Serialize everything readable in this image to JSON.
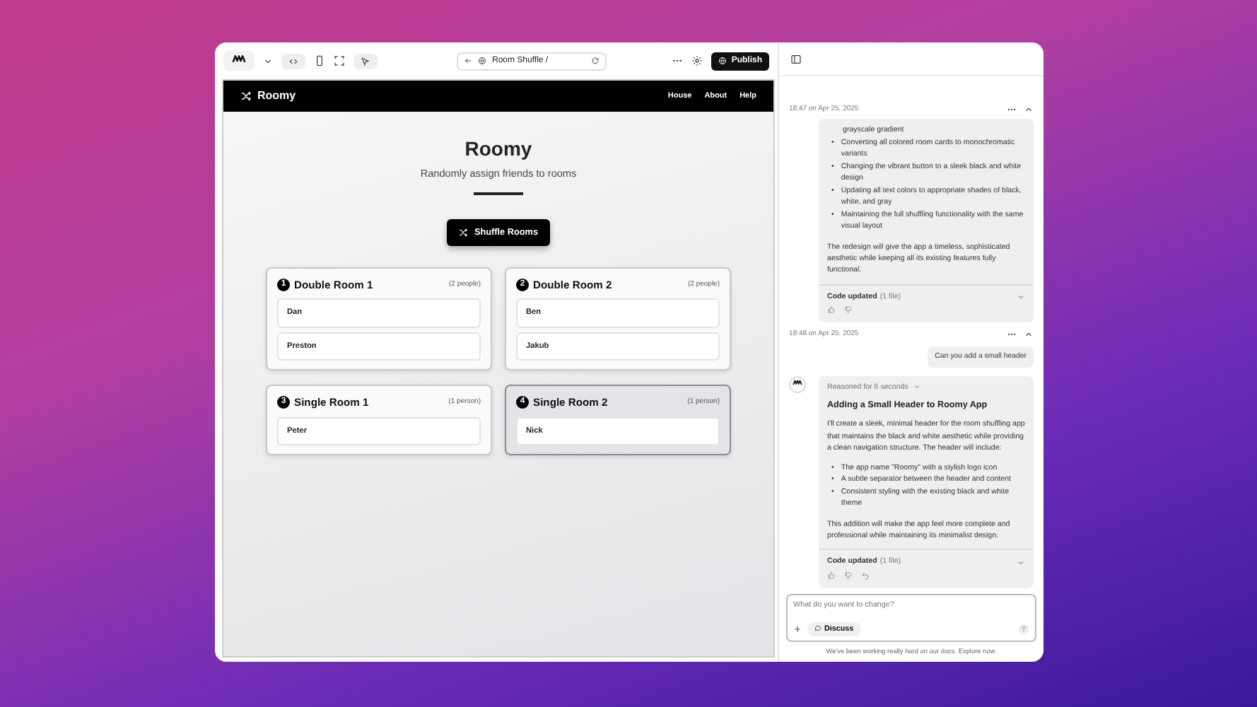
{
  "toolbar": {
    "url": "Room Shuffle /",
    "publish_label": "Publish"
  },
  "app": {
    "brand": "Roomy",
    "nav_links": [
      "House",
      "About",
      "Help"
    ],
    "title": "Roomy",
    "subtitle": "Randomly assign friends to rooms",
    "shuffle_label": "Shuffle Rooms",
    "rooms": [
      {
        "number": "1",
        "name": "Double Room 1",
        "capacity": "(2 people)",
        "highlighted": false,
        "people": [
          "Dan",
          "Preston"
        ]
      },
      {
        "number": "2",
        "name": "Double Room 2",
        "capacity": "(2 people)",
        "highlighted": false,
        "people": [
          "Ben",
          "Jakub"
        ]
      },
      {
        "number": "3",
        "name": "Single Room 1",
        "capacity": "(1 person)",
        "highlighted": false,
        "people": [
          "Peter"
        ]
      },
      {
        "number": "4",
        "name": "Single Room 2",
        "capacity": "(1 person)",
        "highlighted": true,
        "people": [
          "Nick"
        ]
      }
    ]
  },
  "chat": {
    "threads": [
      {
        "time": "18:47 on Apr 25, 2025",
        "reply": {
          "avatar": false,
          "bullet_marker": "•",
          "lead_fragment": "grayscale gradient",
          "bullets": [
            "Converting all colored room cards to monochromatic variants",
            "Changing the vibrant button to a sleek black and white design",
            "Updating all text colors to appropriate shades of black, white, and gray",
            "Maintaining the full shuffling functionality with the same visual layout"
          ],
          "closing": "The redesign will give the app a timeless, sophisticated aesthetic while keeping all its existing features fully functional.",
          "code_status": "Code updated",
          "code_files": "(1 file)",
          "undo": false
        }
      },
      {
        "time": "18:48 on Apr 25, 2025",
        "user_message": "Can you add a small header",
        "reply": {
          "avatar": true,
          "bullet_marker": "•",
          "reasoning": "Reasoned for 6 seconds",
          "heading": "Adding a Small Header to Roomy App",
          "intro": "I'll create a sleek, minimal header for the room shuffling app that maintains the black and white aesthetic while providing a clean navigation structure. The header will include:",
          "bullets": [
            "The app name \"Roomy\" with a stylish logo icon",
            "A subtle separator between the header and content",
            "Consistent styling with the existing black and white theme"
          ],
          "closing": "This addition will make the app feel more complete and professional while maintaining its minimalist design.",
          "code_status": "Code updated",
          "code_files": "(1 file)",
          "undo": true
        }
      }
    ],
    "input_placeholder": "What do you want to change?",
    "discuss_label": "Discuss",
    "footer_text": "We've been working really hard on our docs.",
    "footer_link": "Explore now."
  }
}
